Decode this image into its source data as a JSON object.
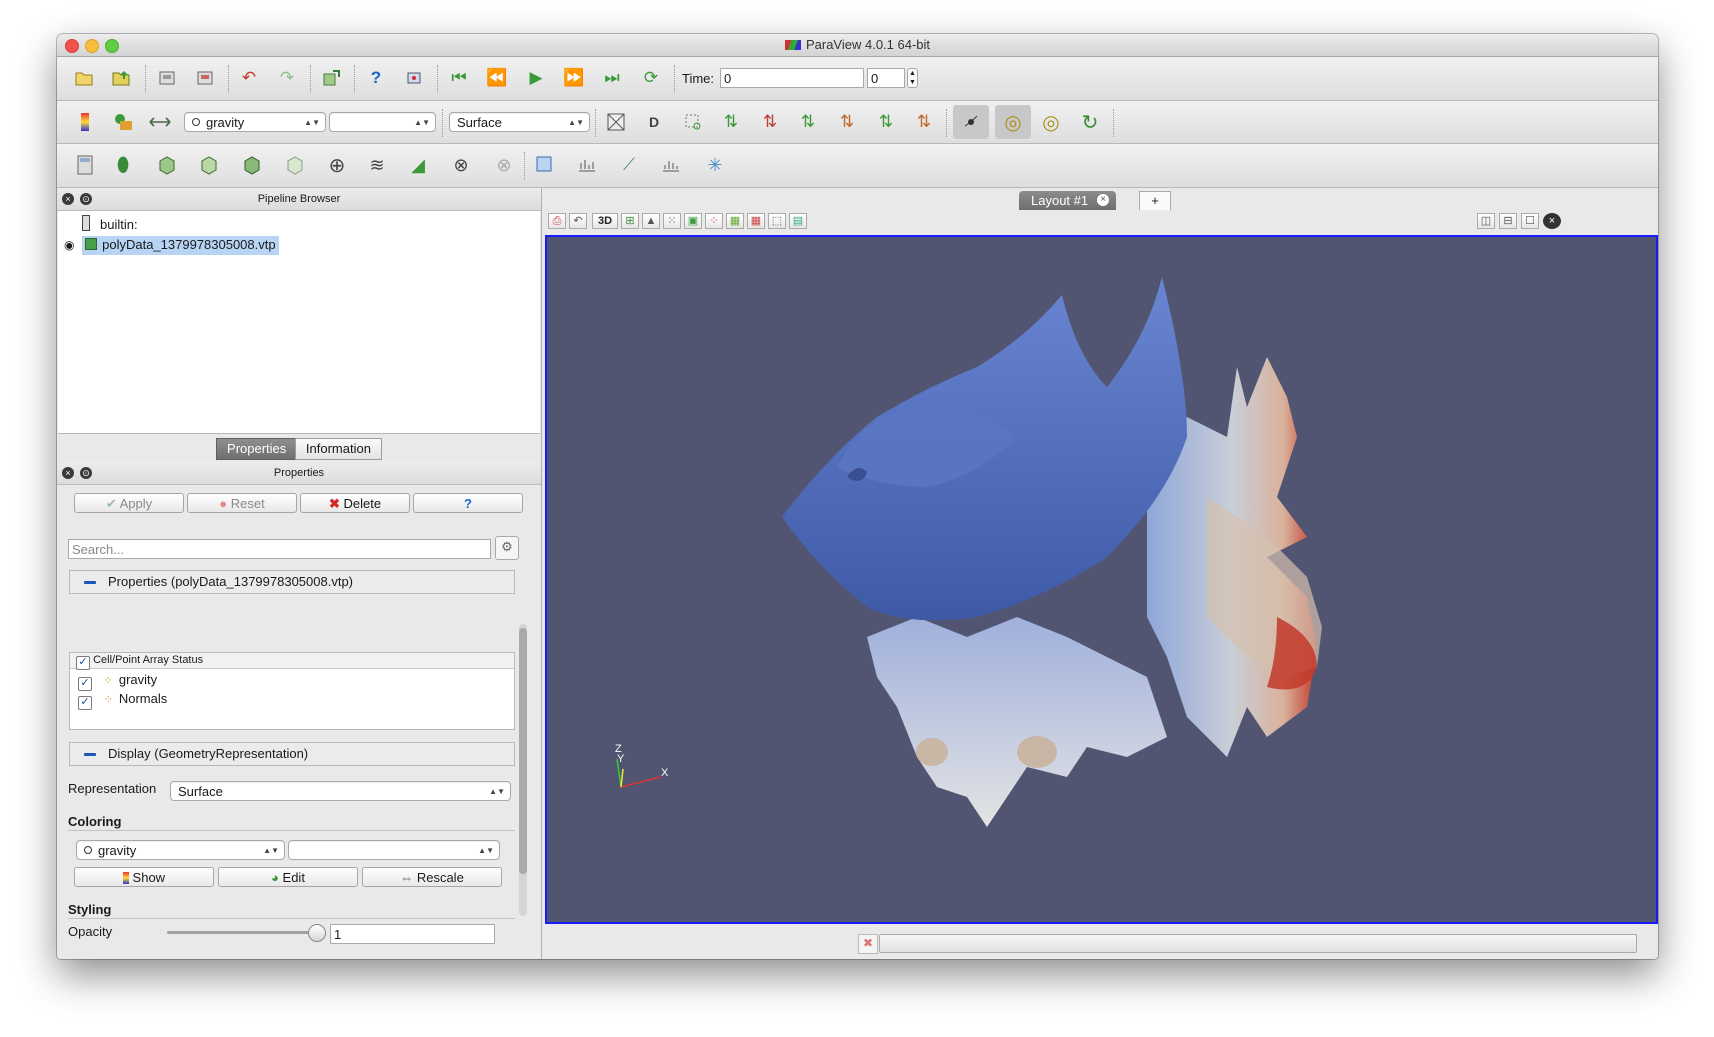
{
  "window": {
    "title": "ParaView 4.0.1 64-bit"
  },
  "toolbar1": {
    "time_label": "Time:",
    "time_value": "0",
    "timestep_value": "0"
  },
  "toolbar2": {
    "color_array": "gravity",
    "color_component": "",
    "representation": "Surface"
  },
  "pipeline_browser": {
    "title": "Pipeline Browser",
    "items": [
      {
        "label": "builtin:"
      },
      {
        "label": "polyData_1379978305008.vtp",
        "selected": true
      }
    ]
  },
  "panel_tabs": [
    "Properties",
    "Information"
  ],
  "properties": {
    "title": "Properties",
    "apply_label": "Apply",
    "reset_label": "Reset",
    "delete_label": "Delete",
    "help_label": "?",
    "search_placeholder": "Search...",
    "section_properties": "Properties (polyData_1379978305008.vtp)",
    "array_status_header": "Cell/Point Array Status",
    "arrays": [
      {
        "name": "gravity",
        "checked": true
      },
      {
        "name": "Normals",
        "checked": true
      }
    ],
    "section_display": "Display (GeometryRepresentation)",
    "representation_label": "Representation",
    "representation_value": "Surface",
    "coloring_label": "Coloring",
    "coloring_array": "gravity",
    "coloring_component": "",
    "show_label": "Show",
    "edit_label": "Edit",
    "rescale_label": "Rescale",
    "styling_label": "Styling",
    "opacity_label": "Opacity",
    "opacity_value": "1",
    "opacity_fraction": 1.0
  },
  "layout": {
    "tab_label": "Layout #1",
    "add_label": "+",
    "view_mode": "3D",
    "background_color": "#525571"
  },
  "axes": {
    "x": "X",
    "y": "Y",
    "z": "Z"
  }
}
